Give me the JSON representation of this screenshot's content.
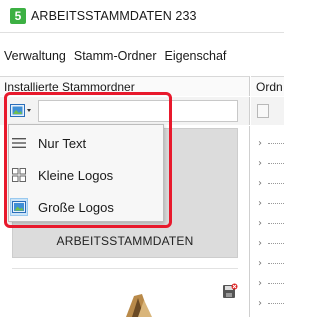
{
  "window": {
    "title": "ARBEITSSTAMMDATEN 233",
    "app_logo_letter": "5"
  },
  "menubar": {
    "items": [
      "Verwaltung",
      "Stamm-Ordner",
      "Eigenschaf"
    ]
  },
  "left_pane": {
    "header": "Installierte Stammordner",
    "card_label": "ARBEITSSTAMMDATEN"
  },
  "right_pane": {
    "header": "Ordn"
  },
  "view_menu": {
    "items": [
      {
        "label": "Nur Text",
        "icon": "list-lines-icon",
        "selected": false
      },
      {
        "label": "Kleine Logos",
        "icon": "small-grid-icon",
        "selected": false
      },
      {
        "label": "Große Logos",
        "icon": "large-image-icon",
        "selected": true
      }
    ]
  },
  "colors": {
    "highlight": "#e8192c",
    "logo_green": "#3cb043",
    "selected_bg": "#cce4f7"
  }
}
